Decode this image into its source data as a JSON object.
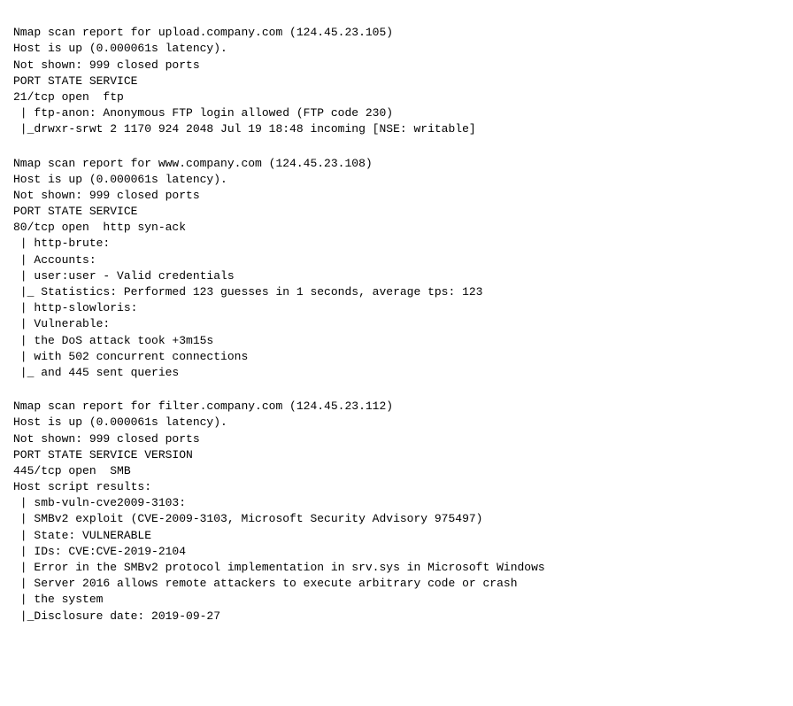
{
  "blocks": [
    {
      "id": "block1",
      "lines": [
        "Nmap scan report for upload.company.com (124.45.23.105)",
        "Host is up (0.000061s latency).",
        "Not shown: 999 closed ports",
        "PORT STATE SERVICE",
        "21/tcp open  ftp",
        " | ftp-anon: Anonymous FTP login allowed (FTP code 230)",
        " |_drwxr-srwt 2 1170 924 2048 Jul 19 18:48 incoming [NSE: writable]"
      ]
    },
    {
      "id": "block2",
      "lines": [
        "Nmap scan report for www.company.com (124.45.23.108)",
        "Host is up (0.000061s latency).",
        "Not shown: 999 closed ports",
        "PORT STATE SERVICE",
        "80/tcp open  http syn-ack",
        " | http-brute:",
        " | Accounts:",
        " | user:user - Valid credentials",
        " |_ Statistics: Performed 123 guesses in 1 seconds, average tps: 123",
        " | http-slowloris:",
        " | Vulnerable:",
        " | the DoS attack took +3m15s",
        " | with 502 concurrent connections",
        " |_ and 445 sent queries"
      ]
    },
    {
      "id": "block3",
      "lines": [
        "Nmap scan report for filter.company.com (124.45.23.112)",
        "Host is up (0.000061s latency).",
        "Not shown: 999 closed ports",
        "PORT STATE SERVICE VERSION",
        "445/tcp open  SMB",
        "Host script results:",
        " | smb-vuln-cve2009-3103:",
        " | SMBv2 exploit (CVE-2009-3103, Microsoft Security Advisory 975497)",
        " | State: VULNERABLE",
        " | IDs: CVE:CVE-2019-2104",
        " | Error in the SMBv2 protocol implementation in srv.sys in Microsoft Windows",
        " | Server 2016 allows remote attackers to execute arbitrary code or crash",
        " | the system",
        " |_Disclosure date: 2019-09-27"
      ]
    }
  ]
}
